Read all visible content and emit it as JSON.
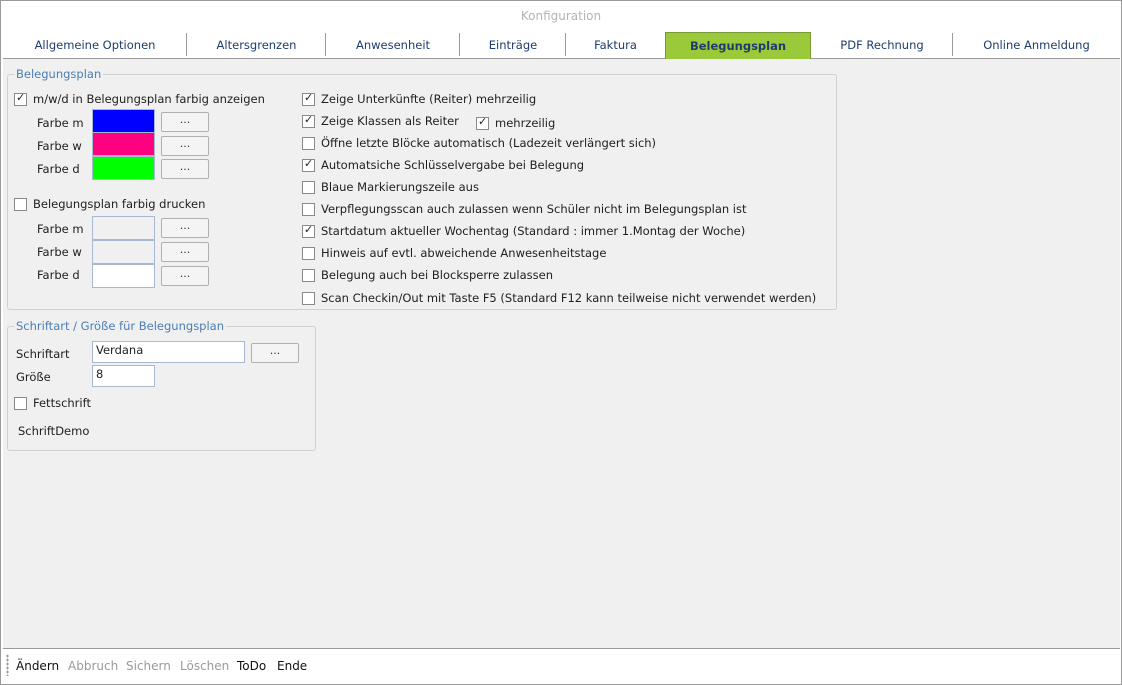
{
  "window": {
    "title": "Konfiguration"
  },
  "tabs": [
    {
      "label": "Allgemeine Optionen",
      "active": false
    },
    {
      "label": "Altersgrenzen",
      "active": false
    },
    {
      "label": "Anwesenheit",
      "active": false
    },
    {
      "label": "Einträge",
      "active": false
    },
    {
      "label": "Faktura",
      "active": false
    },
    {
      "label": "Belegungsplan",
      "active": true
    },
    {
      "label": "PDF Rechnung",
      "active": false
    },
    {
      "label": "Online Anmeldung",
      "active": false
    }
  ],
  "belegungsplan_group": {
    "title": "Belegungsplan",
    "color_display": {
      "label": "m/w/d in Belegungsplan farbig anzeigen",
      "checked": true,
      "rows": [
        {
          "label": "Farbe m",
          "color": "#0000ff",
          "button": "..."
        },
        {
          "label": "Farbe w",
          "color": "#ff0080",
          "button": "..."
        },
        {
          "label": "Farbe d",
          "color": "#00ff00",
          "button": "..."
        }
      ]
    },
    "color_print": {
      "label": "Belegungsplan farbig drucken",
      "checked": false,
      "rows": [
        {
          "label": "Farbe m",
          "color": "#f0f0f0",
          "button": "..."
        },
        {
          "label": "Farbe w",
          "color": "#f0f0f0",
          "button": "..."
        },
        {
          "label": "Farbe d",
          "color": "#ffffff",
          "button": "..."
        }
      ]
    },
    "options": [
      {
        "label": "Zeige Unterkünfte (Reiter) mehrzeilig",
        "checked": true
      },
      {
        "label": "Zeige Klassen als Reiter",
        "checked": true
      },
      {
        "label": "Öffne letzte Blöcke automatisch (Ladezeit verlängert sich)",
        "checked": false
      },
      {
        "label": "Automatsiche Schlüsselvergabe bei Belegung",
        "checked": true
      },
      {
        "label": "Blaue Markierungszeile aus",
        "checked": false
      },
      {
        "label": "Verpflegungsscan auch zulassen wenn Schüler nicht im Belegungsplan ist",
        "checked": false
      },
      {
        "label": "Startdatum aktueller Wochentag (Standard : immer 1.Montag der Woche)",
        "checked": true
      },
      {
        "label": "Hinweis auf evtl. abweichende Anwesenheitstage",
        "checked": false
      },
      {
        "label": "Belegung auch bei Blocksperre zulassen",
        "checked": false
      },
      {
        "label": "Scan Checkin/Out mit Taste F5 (Standard F12 kann teilweise nicht verwendet werden)",
        "checked": false
      }
    ],
    "mehrzeilig": {
      "label": "mehrzeilig",
      "checked": true
    }
  },
  "font_group": {
    "title": "Schriftart / Größe für Belegungsplan",
    "font_label": "Schriftart",
    "font_value": "Verdana",
    "font_button": "...",
    "size_label": "Größe",
    "size_value": "8",
    "bold_label": "Fettschrift",
    "bold_checked": false,
    "demo": "SchriftDemo"
  },
  "footer": [
    {
      "label": "Ändern",
      "enabled": true
    },
    {
      "label": "Abbruch",
      "enabled": false
    },
    {
      "label": "Sichern",
      "enabled": false
    },
    {
      "label": "Löschen",
      "enabled": false
    },
    {
      "label": "ToDo",
      "enabled": true
    },
    {
      "label": "Ende",
      "enabled": true
    }
  ],
  "colors": {
    "active_tab": "#9ac93a",
    "group_title": "#4a7eb5",
    "tab_text": "#1e3c6e"
  }
}
